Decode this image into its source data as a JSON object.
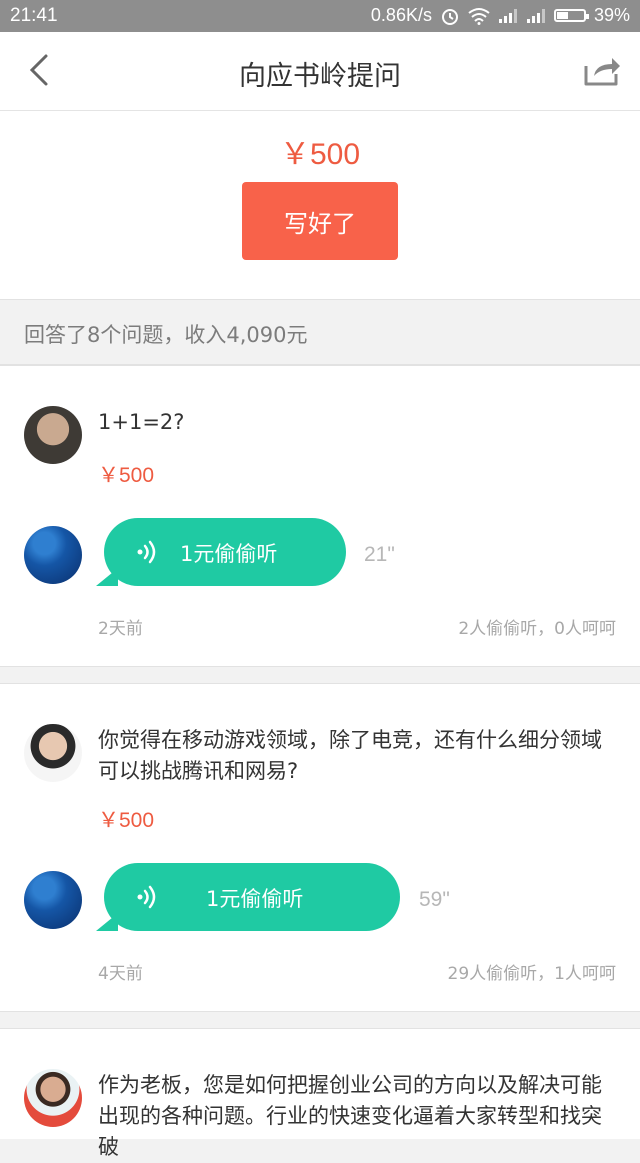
{
  "status_bar": {
    "time": "21:41",
    "network_speed": "0.86K/s",
    "battery": "39%",
    "icons": [
      "alarm-icon",
      "wifi-icon",
      "signal-icon",
      "signal-icon",
      "battery-icon"
    ]
  },
  "nav": {
    "title": "向应书岭提问",
    "back_icon": "back-chevron-icon",
    "share_icon": "share-icon"
  },
  "bounty": {
    "price": "￥500",
    "button_label": "写好了",
    "accent_color": "#f8624a"
  },
  "summary": {
    "text": "回答了8个问题，收入4,090元"
  },
  "questions": [
    {
      "question": "1+1=2?",
      "price": "￥500",
      "listen_label": "1元偷偷听",
      "duration": "21\"",
      "time_ago": "2天前",
      "stats": "2人偷偷听，0人呵呵"
    },
    {
      "question": "你觉得在移动游戏领域，除了电竞，还有什么细分领域可以挑战腾讯和网易?",
      "price": "￥500",
      "listen_label": "1元偷偷听",
      "duration": "59\"",
      "time_ago": "4天前",
      "stats": "29人偷偷听，1人呵呵"
    },
    {
      "question": "作为老板，您是如何把握创业公司的方向以及解决可能出现的各种问题。行业的快速变化逼着大家转型和找突破"
    }
  ],
  "colors": {
    "listen_bubble": "#1fcaa3",
    "price_red": "#ee5b41"
  }
}
